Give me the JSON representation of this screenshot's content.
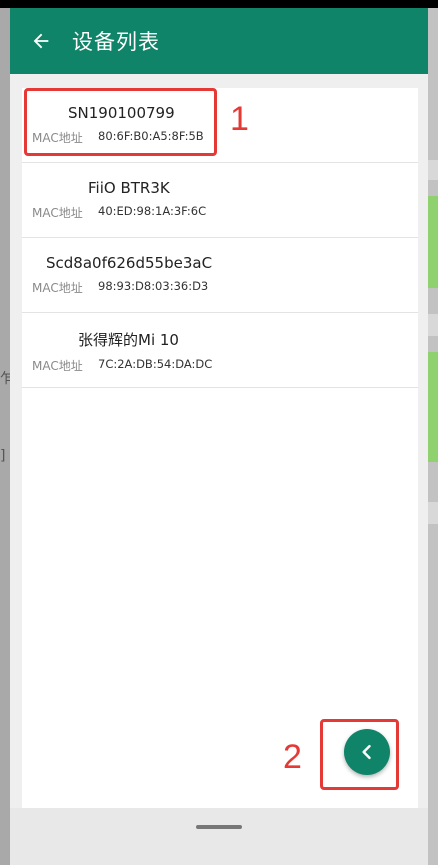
{
  "toolbar": {
    "title": "设备列表"
  },
  "devices": [
    {
      "name": "SN190100799",
      "mac_label": "MAC地址",
      "mac": "80:6F:B0:A5:8F:5B"
    },
    {
      "name": "FiiO BTR3K",
      "mac_label": "MAC地址",
      "mac": "40:ED:98:1A:3F:6C"
    },
    {
      "name": "Scd8a0f626d55be3aC",
      "mac_label": "MAC地址",
      "mac": "98:93:D8:03:36:D3"
    },
    {
      "name": "张得辉的Mi 10",
      "mac_label": "MAC地址",
      "mac": "7C:2A:DB:54:DA:DC"
    }
  ],
  "annotations": {
    "one": "1",
    "two": "2"
  },
  "icons": {
    "back": "arrow-left-icon",
    "fab": "chevron-left-icon"
  },
  "colors": {
    "primary": "#0f8468",
    "annotation": "#e53935"
  }
}
